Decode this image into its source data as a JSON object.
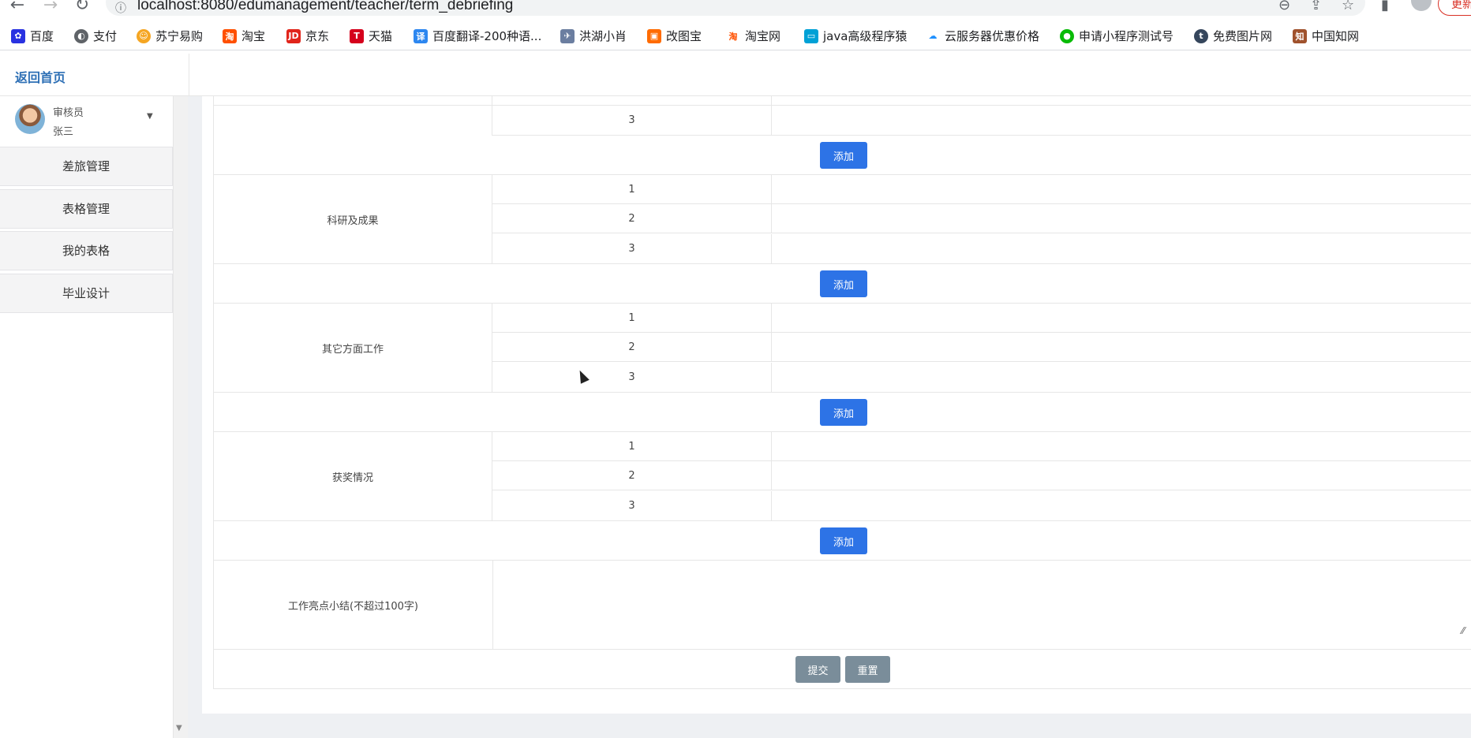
{
  "browser": {
    "url": "localhost:8080/edumanagement/teacher/term_debriefing",
    "update_label": "更新",
    "bookmarks": [
      {
        "label": "百度",
        "icon": "paw-icon",
        "color": "#2932e1"
      },
      {
        "label": "支付",
        "icon": "globe-icon",
        "color": "#5f6368"
      },
      {
        "label": "苏宁易购",
        "icon": "lion-icon",
        "color": "#f5a623"
      },
      {
        "label": "淘宝",
        "icon": "taobao-icon",
        "color": "#ff5000"
      },
      {
        "label": "京东",
        "icon": "jd-icon",
        "color": "#e1251b"
      },
      {
        "label": "天猫",
        "icon": "tmall-icon",
        "color": "#d5001c"
      },
      {
        "label": "百度翻译-200种语...",
        "icon": "translate-icon",
        "color": "#2d87f0"
      },
      {
        "label": "洪湖小肖",
        "icon": "bird-icon",
        "color": "#6b7ea0"
      },
      {
        "label": "改图宝",
        "icon": "image-icon",
        "color": "#ff6b00"
      },
      {
        "label": "淘宝网",
        "icon": "taobao-icon",
        "color": "#ff5000"
      },
      {
        "label": "java高级程序猿",
        "icon": "tv-icon",
        "color": "#00a1d6"
      },
      {
        "label": "云服务器优惠价格",
        "icon": "cloud-icon",
        "color": "#1e90ff"
      },
      {
        "label": "申请小程序测试号",
        "icon": "wechat-icon",
        "color": "#09bb07"
      },
      {
        "label": "免费图片网",
        "icon": "t-icon",
        "color": "#35465c"
      },
      {
        "label": "中国知网",
        "icon": "cnki-icon",
        "color": "#a0522d"
      }
    ]
  },
  "header": {
    "home_link": "返回首页"
  },
  "user": {
    "role": "审核员",
    "name": "张三"
  },
  "sidebar": {
    "items": [
      {
        "label": "差旅管理"
      },
      {
        "label": "表格管理"
      },
      {
        "label": "我的表格"
      },
      {
        "label": "毕业设计"
      }
    ]
  },
  "form": {
    "top_partial": {
      "number": "3"
    },
    "add_label": "添加",
    "sections": [
      {
        "category": "科研及成果",
        "numbers": [
          "1",
          "2",
          "3"
        ]
      },
      {
        "category": "其它方面工作",
        "numbers": [
          "1",
          "2",
          "3"
        ]
      },
      {
        "category": "获奖情况",
        "numbers": [
          "1",
          "2",
          "3"
        ]
      }
    ],
    "summary_label": "工作亮点小结(不超过100字)",
    "summary_value": "",
    "submit_label": "提交",
    "reset_label": "重置"
  }
}
